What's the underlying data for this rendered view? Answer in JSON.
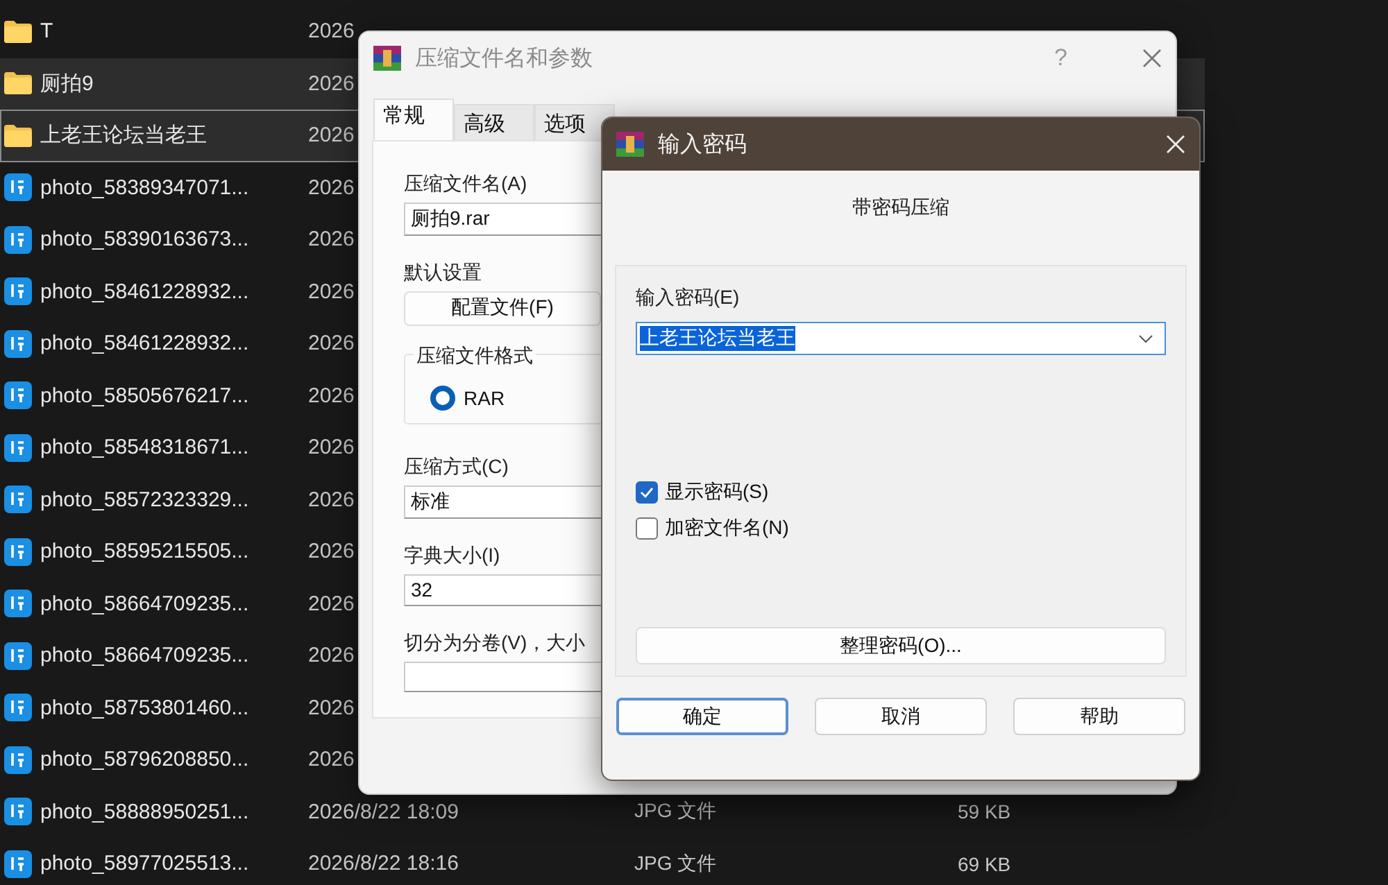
{
  "files": [
    {
      "kind": "folder",
      "name": "T",
      "date": "2026",
      "selected": false,
      "focused": false
    },
    {
      "kind": "folder",
      "name": "厕拍9",
      "date": "2026",
      "selected": true,
      "focused": false
    },
    {
      "kind": "folder",
      "name": "上老王论坛当老王",
      "date": "2026",
      "selected": true,
      "focused": true
    },
    {
      "kind": "image",
      "name": "photo_58389347071...",
      "date": "2026",
      "selected": false,
      "focused": false
    },
    {
      "kind": "image",
      "name": "photo_58390163673...",
      "date": "2026",
      "selected": false,
      "focused": false
    },
    {
      "kind": "image",
      "name": "photo_58461228932...",
      "date": "2026",
      "selected": false,
      "focused": false
    },
    {
      "kind": "image",
      "name": "photo_58461228932...",
      "date": "2026",
      "selected": false,
      "focused": false
    },
    {
      "kind": "image",
      "name": "photo_58505676217...",
      "date": "2026",
      "selected": false,
      "focused": false
    },
    {
      "kind": "image",
      "name": "photo_58548318671...",
      "date": "2026",
      "selected": false,
      "focused": false
    },
    {
      "kind": "image",
      "name": "photo_58572323329...",
      "date": "2026",
      "selected": false,
      "focused": false
    },
    {
      "kind": "image",
      "name": "photo_58595215505...",
      "date": "2026",
      "selected": false,
      "focused": false
    },
    {
      "kind": "image",
      "name": "photo_58664709235...",
      "date": "2026",
      "selected": false,
      "focused": false
    },
    {
      "kind": "image",
      "name": "photo_58664709235...",
      "date": "2026",
      "selected": false,
      "focused": false
    },
    {
      "kind": "image",
      "name": "photo_58753801460...",
      "date": "2026",
      "selected": false,
      "focused": false
    },
    {
      "kind": "image",
      "name": "photo_58796208850...",
      "date": "2026",
      "selected": false,
      "focused": false
    },
    {
      "kind": "image",
      "name": "photo_58888950251...",
      "date": "2026/8/22 18:09",
      "type": "JPG 文件",
      "size": "59 KB",
      "selected": false,
      "focused": false
    },
    {
      "kind": "image",
      "name": "photo_58977025513...",
      "date": "2026/8/22 18:16",
      "type": "JPG 文件",
      "size": "69 KB",
      "selected": false,
      "focused": false
    }
  ],
  "archive_dialog": {
    "title": "压缩文件名和参数",
    "help": "?",
    "tabs": [
      {
        "label": "常规",
        "selected": true
      },
      {
        "label": "高级",
        "selected": false
      },
      {
        "label": "选项",
        "selected": false
      }
    ],
    "archive_name_label": "压缩文件名(A)",
    "archive_name": "厕拍9.rar",
    "default_settings_label": "默认设置",
    "profiles_button": "配置文件(F)",
    "format_group": "压缩文件格式",
    "format_options": [
      {
        "label": "RAR",
        "selected": true
      }
    ],
    "method_label": "压缩方式(C)",
    "method": "标准",
    "dictionary_label": "字典大小(I)",
    "dictionary": "32",
    "split_label": "切分为分卷(V)，大小"
  },
  "password_dialog": {
    "title": "输入密码",
    "subtitle": "带密码压缩",
    "password_label": "输入密码(E)",
    "password": "上老王论坛当老王",
    "options": [
      {
        "label": "显示密码(S)",
        "checked": true
      },
      {
        "label": "加密文件名(N)",
        "checked": false
      }
    ],
    "organize_button": "整理密码(O)...",
    "buttons": [
      {
        "label": "确定",
        "default": true
      },
      {
        "label": "取消",
        "default": false
      },
      {
        "label": "帮助",
        "default": false
      }
    ]
  }
}
